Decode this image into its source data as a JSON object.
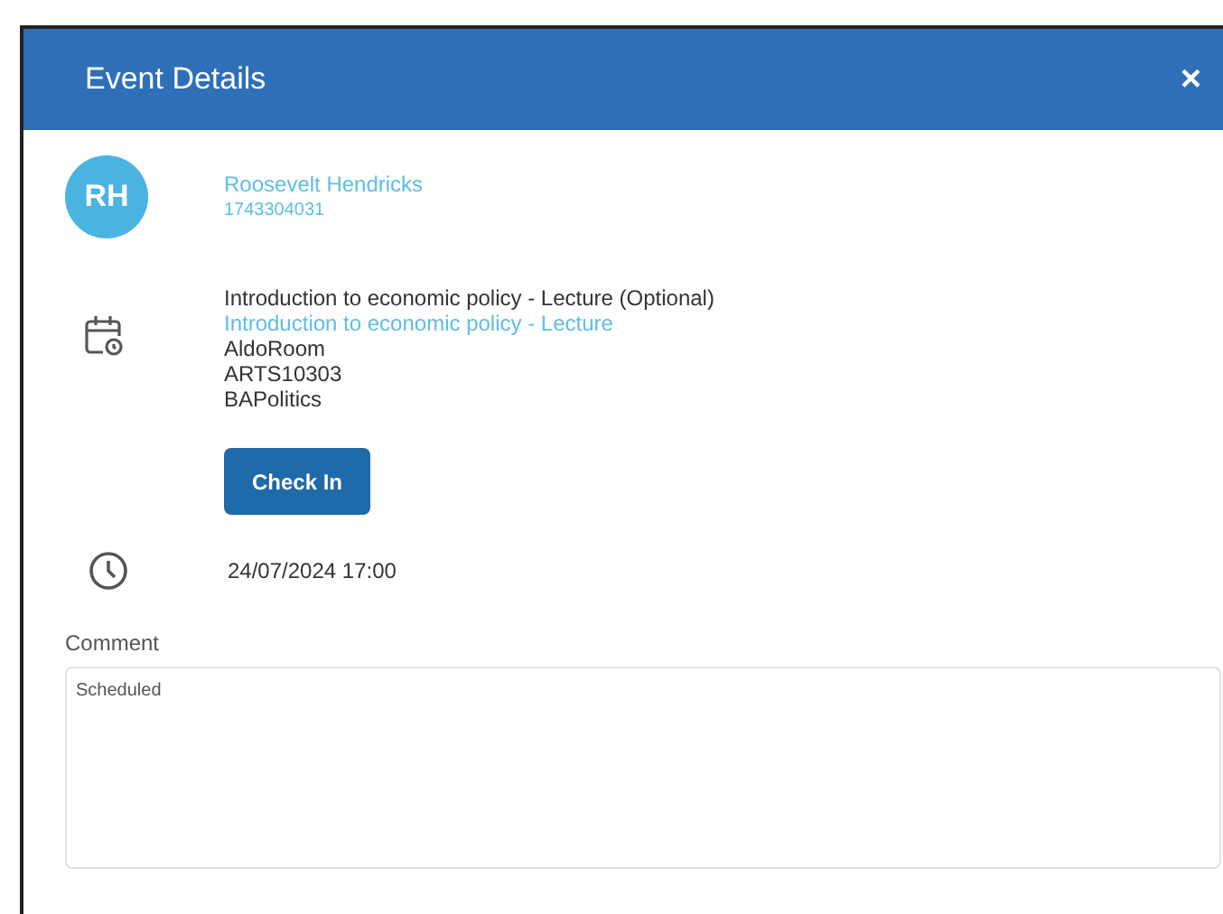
{
  "dialog": {
    "title": "Event Details",
    "close": "×"
  },
  "person": {
    "initials": "RH",
    "name": "Roosevelt Hendricks",
    "id": "1743304031"
  },
  "event": {
    "lines": [
      {
        "text": "Introduction to economic policy - Lecture (Optional)",
        "kind": "plain"
      },
      {
        "text": "Introduction to economic policy - Lecture",
        "kind": "link"
      },
      {
        "text": "AldoRoom",
        "kind": "plain"
      },
      {
        "text": "ARTS10303",
        "kind": "plain"
      },
      {
        "text": "BAPolitics",
        "kind": "plain"
      }
    ],
    "button": "Check In",
    "datetime": "24/07/2024 17:00"
  },
  "comment": {
    "label": "Comment",
    "value": "Scheduled"
  }
}
